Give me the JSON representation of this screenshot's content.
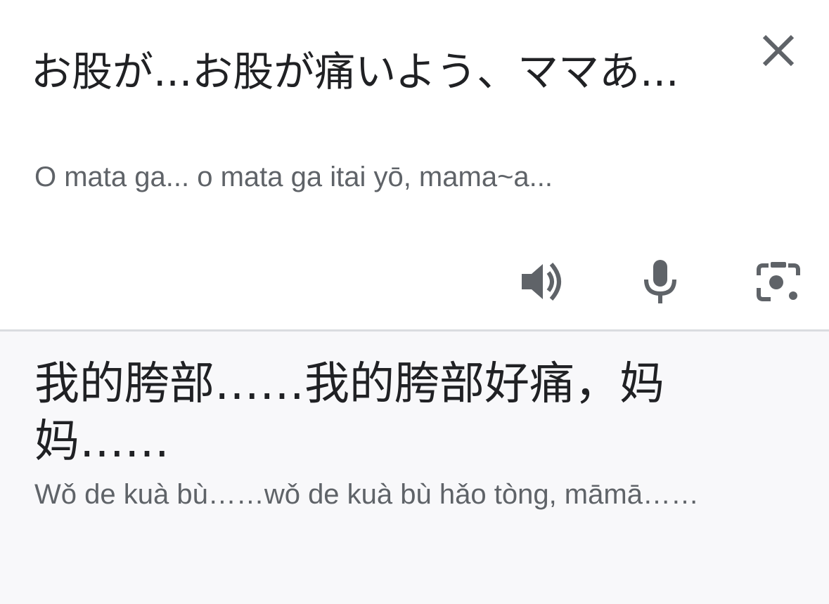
{
  "source": {
    "text": "お股が...お股が痛いよう、ママあ...",
    "romanization": "O mata ga... o mata ga itai yō, mama~a...",
    "close_icon": "close-icon",
    "toolbar": {
      "speaker_icon": "speaker-icon",
      "mic_icon": "microphone-icon",
      "camera_icon": "camera-lens-icon"
    }
  },
  "result": {
    "text": "我的胯部……我的胯部好痛，妈妈……",
    "romanization": "Wǒ de kuà bù……wǒ de kuà bù hǎo tòng, māmā……"
  },
  "colors": {
    "text_primary": "#202124",
    "text_secondary": "#5f6368",
    "icon": "#5f6368",
    "result_background": "#f8f8fa",
    "divider": "#dadce0"
  }
}
